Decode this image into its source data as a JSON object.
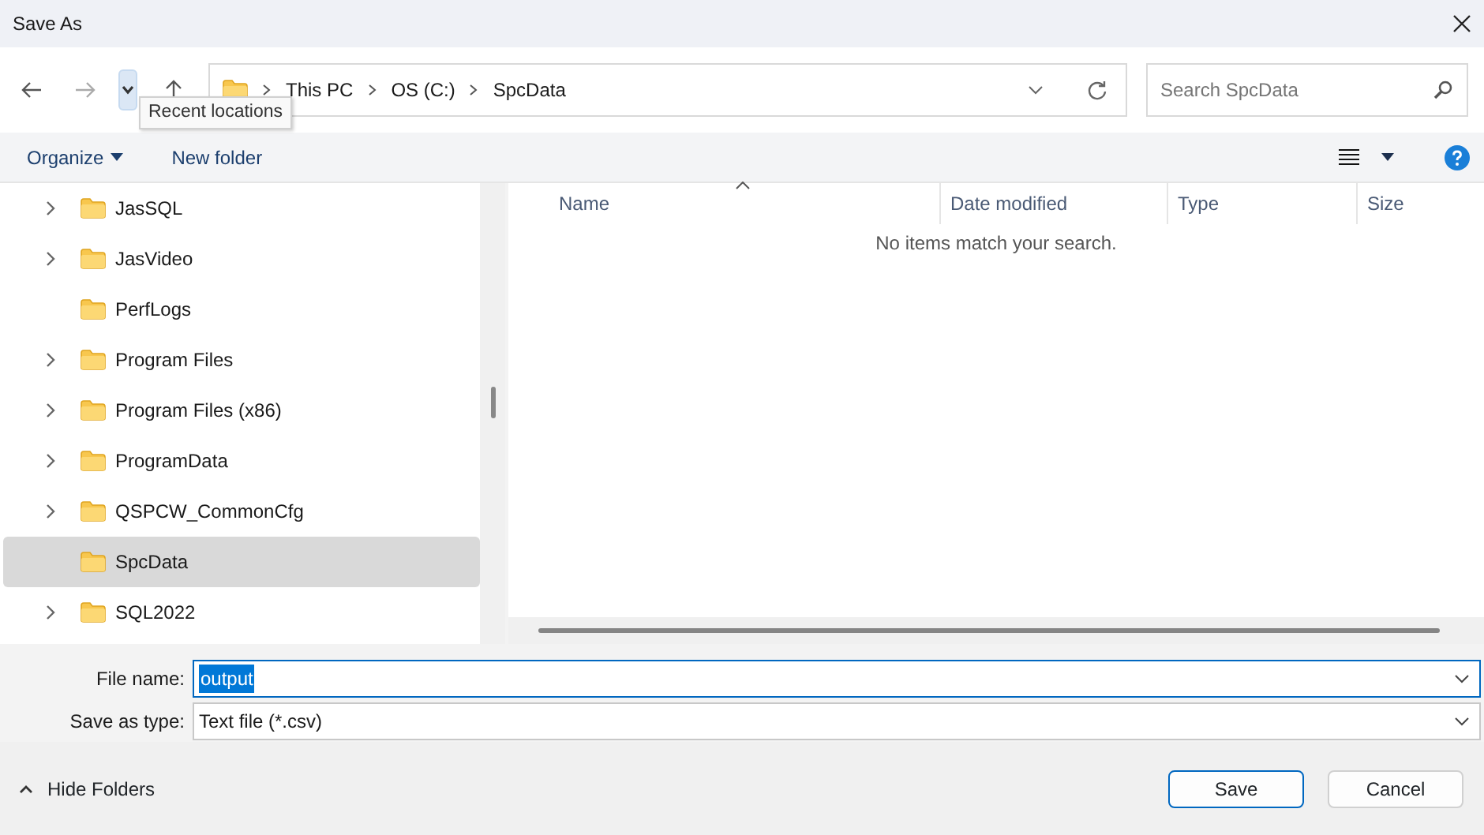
{
  "window": {
    "title": "Save As"
  },
  "nav": {
    "recent_tooltip": "Recent locations",
    "breadcrumb": [
      "This PC",
      "OS (C:)",
      "SpcData"
    ],
    "search": {
      "placeholder": "Search SpcData"
    }
  },
  "toolbar": {
    "organize": "Organize",
    "new_folder": "New folder"
  },
  "tree": [
    {
      "label": "JasSQL",
      "expandable": true,
      "selected": false
    },
    {
      "label": "JasVideo",
      "expandable": true,
      "selected": false
    },
    {
      "label": "PerfLogs",
      "expandable": false,
      "selected": false
    },
    {
      "label": "Program Files",
      "expandable": true,
      "selected": false
    },
    {
      "label": "Program Files (x86)",
      "expandable": true,
      "selected": false
    },
    {
      "label": "ProgramData",
      "expandable": true,
      "selected": false
    },
    {
      "label": "QSPCW_CommonCfg",
      "expandable": true,
      "selected": false
    },
    {
      "label": "SpcData",
      "expandable": false,
      "selected": true
    },
    {
      "label": "SQL2022",
      "expandable": true,
      "selected": false
    }
  ],
  "columns": [
    "Name",
    "Date modified",
    "Type",
    "Size"
  ],
  "empty_message": "No items match your search.",
  "file_name": {
    "label": "File name:",
    "value": "output",
    "value_selected": true
  },
  "save_as_type": {
    "label": "Save as type:",
    "value": "Text file (*.csv)"
  },
  "hide_folders": "Hide Folders",
  "buttons": [
    {
      "label": "Save",
      "kind": "primary"
    },
    {
      "label": "Cancel",
      "kind": "secondary"
    }
  ]
}
